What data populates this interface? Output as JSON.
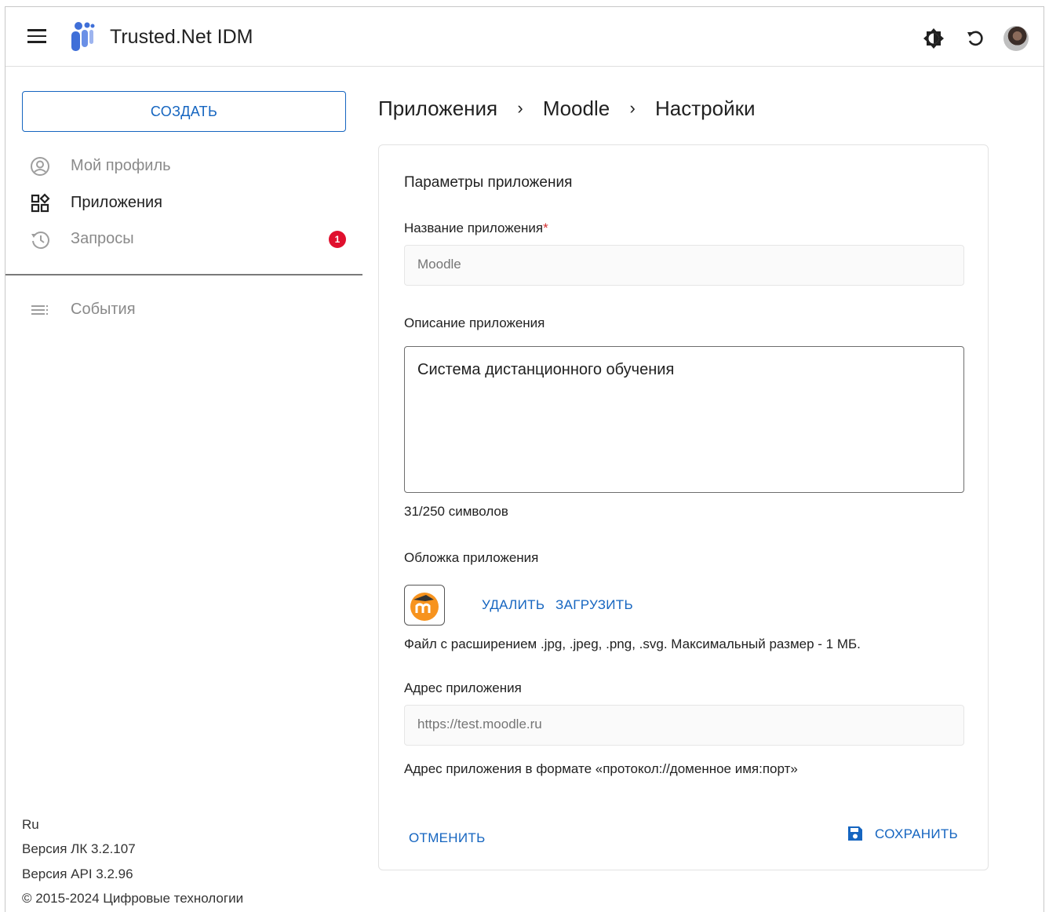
{
  "header": {
    "app_title": "Trusted.Net IDM",
    "icons": [
      "menu-icon",
      "app-logo-icon",
      "theme-toggle-icon",
      "refresh-icon",
      "user-avatar"
    ]
  },
  "sidebar": {
    "create_label": "СОЗДАТЬ",
    "items": [
      {
        "label": "Мой профиль",
        "icon": "user-circle-icon",
        "state": "dim"
      },
      {
        "label": "Приложения",
        "icon": "apps-grid-icon",
        "state": "active"
      },
      {
        "label": "Запросы",
        "icon": "history-icon",
        "state": "dim",
        "badge": "1"
      },
      {
        "label": "События",
        "icon": "list-icon",
        "state": "dim"
      }
    ],
    "footer": {
      "language": "Ru",
      "lk_version": "Версия ЛК 3.2.107",
      "api_version": "Версия API 3.2.96",
      "copyright": "© 2015-2024 Цифровые технологии"
    }
  },
  "breadcrumb": [
    "Приложения",
    "Moodle",
    "Настройки"
  ],
  "form": {
    "title": "Параметры приложения",
    "name_label": "Название приложения",
    "name_required_mark": "*",
    "name_value": "Moodle",
    "description_label": "Описание приложения",
    "description_value": "Система дистанционного обучения",
    "description_counter": "31/250 символов",
    "cover_label": "Обложка приложения",
    "cover_delete": "УДАЛИТЬ",
    "cover_upload": "ЗАГРУЗИТЬ",
    "cover_hint": "Файл с расширением .jpg, .jpeg, .png, .svg. Максимальный размер - 1 МБ.",
    "address_label": "Адрес приложения",
    "address_value": "https://test.moodle.ru",
    "address_hint": "Адрес приложения в формате «протокол://доменное имя:порт»",
    "cancel_label": "ОТМЕНИТЬ",
    "save_label": "СОХРАНИТЬ"
  },
  "colors": {
    "accent": "#1565c0",
    "badge": "#e0102e",
    "moodle_orange": "#f7931e"
  }
}
